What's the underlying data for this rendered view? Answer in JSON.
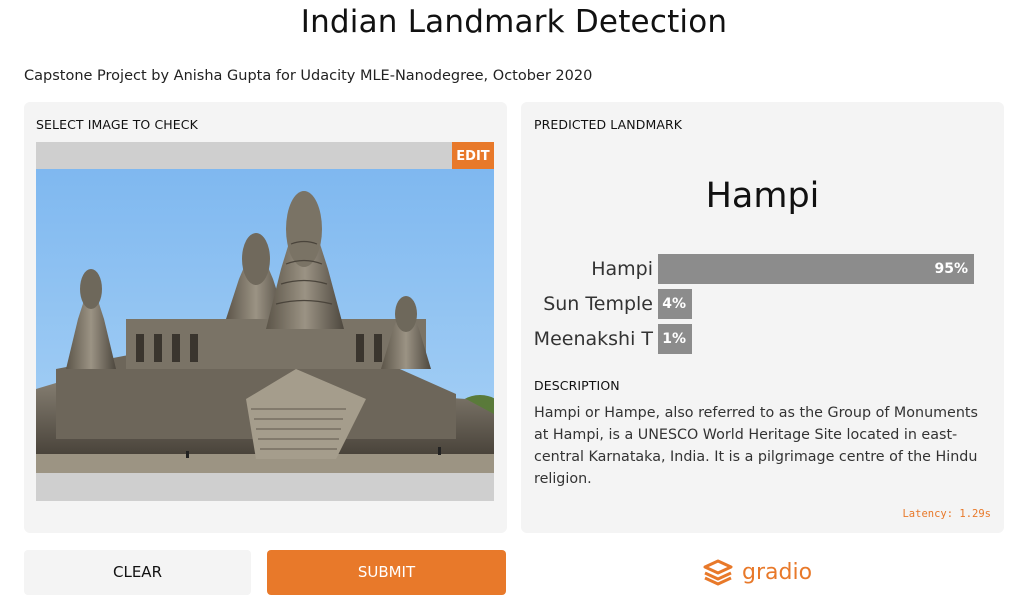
{
  "header": {
    "title": "Indian Landmark Detection",
    "subtitle": "Capstone Project by Anisha Gupta for Udacity MLE-Nanodegree, October 2020"
  },
  "input_panel": {
    "label": "SELECT IMAGE TO CHECK",
    "edit_label": "EDIT"
  },
  "output_panel": {
    "label": "PREDICTED LANDMARK",
    "predicted": "Hampi",
    "confidences": [
      {
        "label": "Hampi",
        "value_text": "95%",
        "fraction": 0.95
      },
      {
        "label": "Sun Temple",
        "value_text": "4%",
        "fraction": 0.04
      },
      {
        "label": "Meenakshi T",
        "value_text": "1%",
        "fraction": 0.01
      }
    ],
    "description_label": "DESCRIPTION",
    "description": "Hampi or Hampe, also referred to as the Group of Monuments at Hampi, is a UNESCO World Heritage Site located in east-central Karnataka, India. It is a pilgrimage centre of the Hindu religion.",
    "latency": "Latency: 1.29s"
  },
  "actions": {
    "clear_label": "CLEAR",
    "submit_label": "SUBMIT"
  },
  "footer": {
    "brand": "gradio",
    "brand_icon": "gradio-logo-icon"
  },
  "colors": {
    "accent": "#e8792a",
    "panel_bg": "#f4f4f4",
    "bar_fill": "#8c8c8c"
  }
}
